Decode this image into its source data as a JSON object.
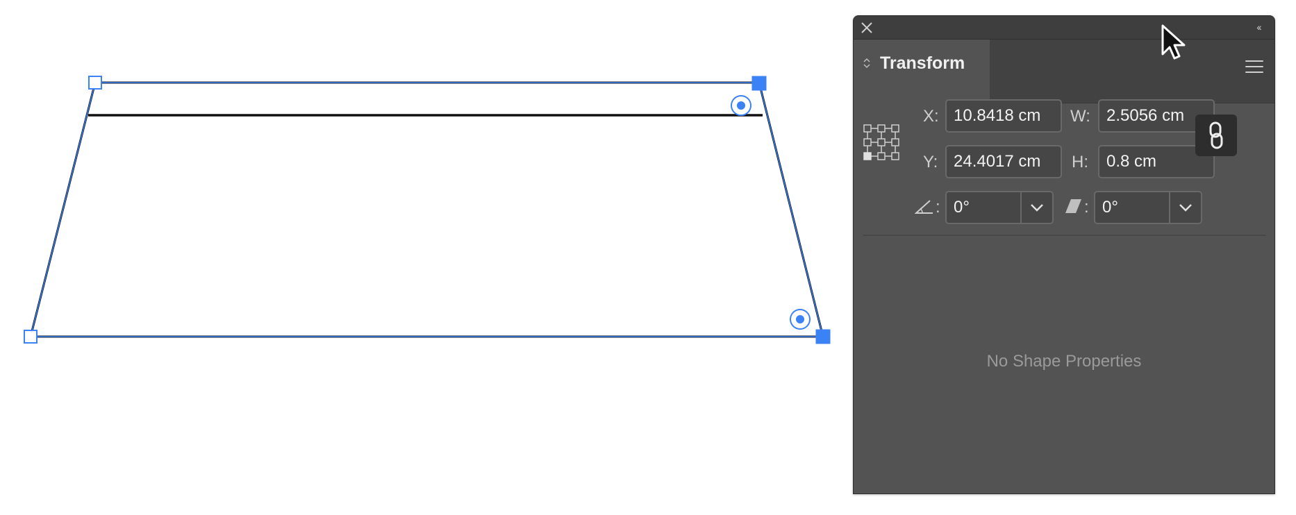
{
  "panel": {
    "close_icon": "close-icon",
    "collapse_label": "‹‹",
    "tab": {
      "label": "Transform",
      "icon": "tab-stepper-icon"
    },
    "menu_icon": "hamburger-menu-icon",
    "fields": {
      "x_label": "X:",
      "x_value": "10.8418 cm",
      "y_label": "Y:",
      "y_value": "24.4017 cm",
      "w_label": "W:",
      "w_value": "2.5056 cm",
      "h_label": "H:",
      "h_value": "0.8 cm",
      "rotate_label": ":",
      "rotate_value": "0°",
      "shear_label": ":",
      "shear_value": "0°"
    },
    "constrain_icon": "link-icon",
    "reference_point_icon": "reference-point-locator-icon",
    "empty_message": "No Shape Properties"
  },
  "colors": {
    "selection": "#3b82f6",
    "panel_bg": "#535353",
    "stroke": "#000000"
  }
}
